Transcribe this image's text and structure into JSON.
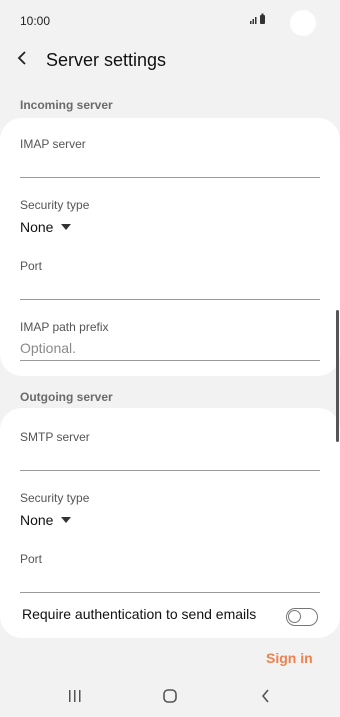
{
  "status_bar": {
    "time": "10:00",
    "signal_icon": "signal-battery-icons"
  },
  "header": {
    "back_icon": "back-arrow-icon",
    "title": "Server settings"
  },
  "incoming": {
    "section_title": "Incoming server",
    "imap_server_label": "IMAP server",
    "imap_server_value": "",
    "security_type_label": "Security type",
    "security_type_value": "None",
    "port_label": "Port",
    "port_value": "",
    "imap_path_prefix_label": "IMAP path prefix",
    "imap_path_prefix_placeholder": "Optional."
  },
  "outgoing": {
    "section_title": "Outgoing server",
    "smtp_server_label": "SMTP server",
    "smtp_server_value": "",
    "security_type_label": "Security type",
    "security_type_value": "None",
    "port_label": "Port",
    "port_value": "",
    "require_auth_label": "Require authentication to send emails",
    "require_auth_enabled": false
  },
  "actions": {
    "sign_in_label": "Sign in",
    "accent_color": "#f0804e"
  },
  "navigation": {
    "recents_icon": "recents-icon",
    "home_icon": "home-icon",
    "back_icon": "back-nav-icon"
  }
}
